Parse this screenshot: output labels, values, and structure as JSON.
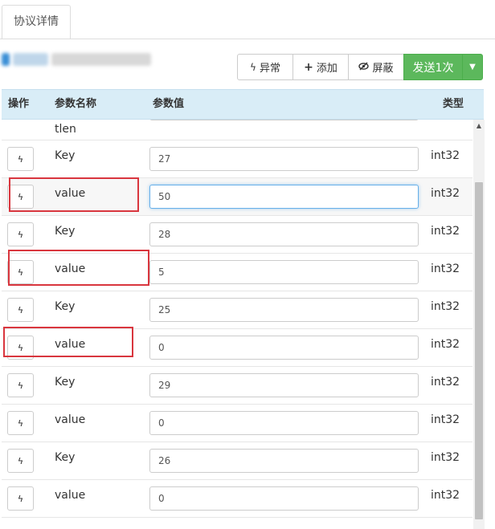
{
  "tab": {
    "label": "协议详情"
  },
  "toolbar": {
    "exception_label": "异常",
    "add_label": "添加",
    "mask_label": "屏蔽",
    "send_label": "发送1次"
  },
  "table": {
    "headers": {
      "op": "操作",
      "name": "参数名称",
      "value": "参数值",
      "type": "类型"
    },
    "partial_row_name": "tlen",
    "rows": [
      {
        "name": "Key",
        "value": "27",
        "type": "int32"
      },
      {
        "name": "value",
        "value": "50",
        "type": "int32"
      },
      {
        "name": "Key",
        "value": "28",
        "type": "int32"
      },
      {
        "name": "value",
        "value": "5",
        "type": "int32"
      },
      {
        "name": "Key",
        "value": "25",
        "type": "int32"
      },
      {
        "name": "value",
        "value": "0",
        "type": "int32"
      },
      {
        "name": "Key",
        "value": "29",
        "type": "int32"
      },
      {
        "name": "value",
        "value": "0",
        "type": "int32"
      },
      {
        "name": "Key",
        "value": "26",
        "type": "int32"
      },
      {
        "name": "value",
        "value": "0",
        "type": "int32"
      }
    ]
  },
  "colors": {
    "header_bg": "#d9edf7",
    "primary": "#5cb85c",
    "highlight_box": "#d9363e",
    "focus": "#66afe9"
  },
  "icons": {
    "exception": "bolt-icon",
    "add": "plus-icon",
    "mask": "eye-slash-icon",
    "row_op": "bolt-icon",
    "dropdown": "caret-down-icon"
  }
}
